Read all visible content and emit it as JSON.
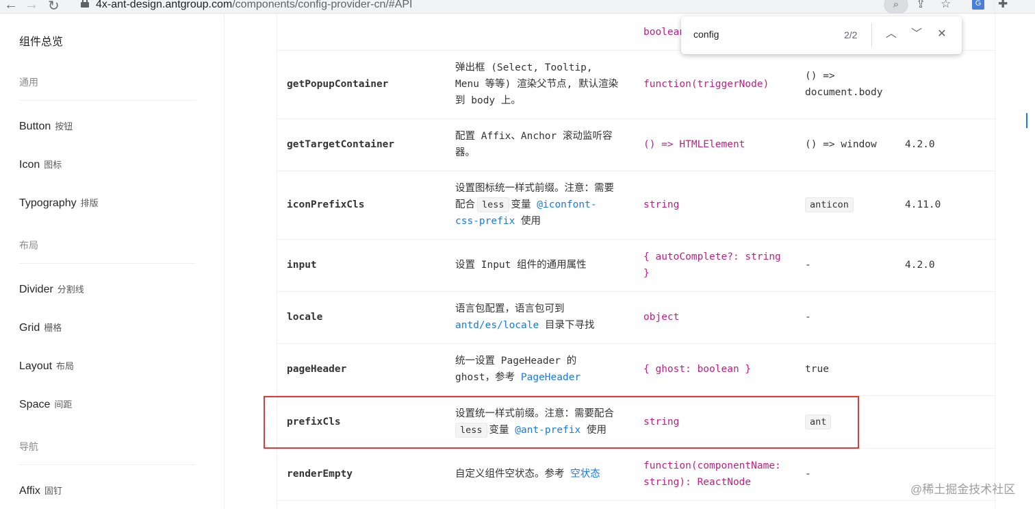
{
  "browser": {
    "url_host": "4x-ant-design.antgroup.com",
    "url_path": "/components/config-provider-cn/#API",
    "icons": [
      "back-arrow-icon",
      "forward-arrow-icon",
      "reload-icon",
      "lock-icon",
      "lens-icon",
      "share-icon",
      "star-icon",
      "translate-icon",
      "extensions-icon"
    ]
  },
  "find_bar": {
    "query": "config",
    "count": "2/2"
  },
  "sidebar": {
    "title": "组件总览",
    "groups": [
      {
        "label": "通用",
        "items": [
          {
            "en": "Button",
            "cn": "按钮"
          },
          {
            "en": "Icon",
            "cn": "图标"
          },
          {
            "en": "Typography",
            "cn": "排版"
          }
        ]
      },
      {
        "label": "布局",
        "items": [
          {
            "en": "Divider",
            "cn": "分割线"
          },
          {
            "en": "Grid",
            "cn": "栅格"
          },
          {
            "en": "Layout",
            "cn": "布局"
          },
          {
            "en": "Space",
            "cn": "间距"
          }
        ]
      },
      {
        "label": "导航",
        "items": [
          {
            "en": "Affix",
            "cn": "固钉"
          }
        ]
      }
    ]
  },
  "table": {
    "top_partial_type": "boolean",
    "rows": [
      {
        "prop": "getPopupContainer",
        "desc_l1": "弹出框 (Select, Tooltip,",
        "desc_l2": "Menu 等等) 渲染父节点, 默认渲染",
        "desc_l3": "到 body 上。",
        "type": "function(triggerNode)",
        "default_l1": "() =>",
        "default_l2": "document.body",
        "version": ""
      },
      {
        "prop": "getTargetContainer",
        "desc_l1": "配置 Affix、Anchor 滚动监听容",
        "desc_l2": "器。",
        "type": "() => HTMLElement",
        "default": "() => window",
        "version": "4.2.0"
      },
      {
        "prop": "iconPrefixCls",
        "desc_l1": "设置图标统一样式前缀。注意：需要",
        "desc_pre": "配合",
        "desc_code": "less",
        "desc_mid": "变量",
        "desc_link1": "@iconfont-",
        "desc_link2": "css-prefix",
        "desc_post": "使用",
        "type": "string",
        "default": "anticon",
        "version": "4.11.0"
      },
      {
        "prop": "input",
        "desc": "设置 Input 组件的通用属性",
        "type_l1": "{ autoComplete?: string",
        "type_l2": "}",
        "default": "-",
        "version": "4.2.0"
      },
      {
        "prop": "locale",
        "desc_l1": "语言包配置，语言包可到",
        "desc_link": "antd/es/locale",
        "desc_post": "目录下寻找",
        "type": "object",
        "default": "-",
        "version": ""
      },
      {
        "prop": "pageHeader",
        "desc_l1": "统一设置 PageHeader 的",
        "desc_pre": "ghost，参考",
        "desc_link": "PageHeader",
        "type": "{ ghost: boolean }",
        "default": "true",
        "version": ""
      },
      {
        "prop": "prefixCls",
        "desc_l1": "设置统一样式前缀。注意：需要配合",
        "desc_code": "less",
        "desc_mid": "变量",
        "desc_link": "@ant-prefix",
        "desc_post": "使用",
        "type": "string",
        "default": "ant",
        "version": ""
      },
      {
        "prop": "renderEmpty",
        "desc_pre": "自定义组件空状态。参考",
        "desc_link": "空状态",
        "type_l1": "function(componentName:",
        "type_l2": "string): ReactNode",
        "default": "-",
        "version": ""
      }
    ]
  },
  "watermark": "@稀土掘金技术社区",
  "colors": {
    "highlight": "#e53935",
    "link": "#1677ff",
    "type": "#c41d7f"
  }
}
